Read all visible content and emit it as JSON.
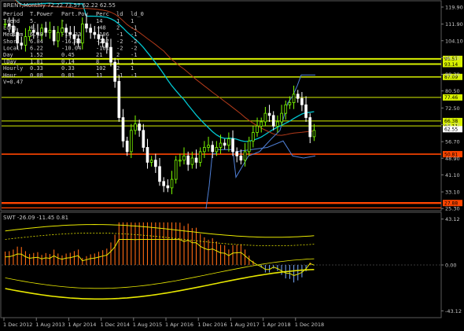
{
  "window": {
    "title": "BRENT,Monthly",
    "ohlc": "72.22 73.57 62.22 62.55"
  },
  "indicator": {
    "title": "SWT -26.09 -11.45 0.81"
  },
  "table": {
    "headers": [
      "Period",
      "T.Power",
      "Part.Pow",
      "Perc",
      "ld",
      "ld_0"
    ],
    "rows": [
      [
        "Trend",
        "5.",
        "-",
        "14",
        "1",
        "1"
      ],
      [
        "Long",
        "4.",
        "-",
        "-48",
        "2",
        "-1"
      ],
      [
        "Medium",
        "6.48",
        "-15.33",
        "-106",
        "-1",
        "-1"
      ],
      [
        "Short",
        "6.84",
        "-16.88",
        "-247",
        "-2",
        "-2"
      ],
      [
        "Local",
        "6.22",
        "-10.04",
        "-161",
        "-2",
        "-2"
      ],
      [
        "Day",
        "1.52",
        "0.45",
        "21",
        "2",
        "-1"
      ],
      [
        "lDay",
        "1.81",
        "0.14",
        "8",
        "1",
        "1"
      ],
      [
        "Hourly",
        "0.33",
        "0.33",
        "102",
        "2",
        "1"
      ],
      [
        "Hour",
        "0.08",
        "0.01",
        "11",
        "-1",
        "-1"
      ]
    ],
    "footer": "V=0.47"
  },
  "price_axis": {
    "ticks": [
      "119.90",
      "111.90",
      "104.10",
      "96.10",
      "88.30",
      "80.50",
      "72.50",
      "64.70",
      "56.70",
      "48.90",
      "41.10",
      "33.10",
      "25.30"
    ],
    "tags": [
      {
        "value": "95.57",
        "color": "#d7f000"
      },
      {
        "value": "93.14",
        "color": "#d7f000"
      },
      {
        "value": "87.09",
        "color": "#d7f000"
      },
      {
        "value": "77.46",
        "color": "#d7f000"
      },
      {
        "value": "66.38",
        "color": "#d7f000"
      },
      {
        "value": "64.11",
        "color": "#d7f000"
      },
      {
        "value": "62.55",
        "color": "#ffffff"
      },
      {
        "value": "50.81",
        "color": "#ff4500"
      },
      {
        "value": "27.88",
        "color": "#ff4500"
      }
    ]
  },
  "indicator_axis": {
    "ticks": [
      "43.12",
      "0.00",
      "-43.12"
    ]
  },
  "time_axis": {
    "labels": [
      "1 Dec 2012",
      "1 Aug 2013",
      "1 Apr 2014",
      "1 Dec 2014",
      "1 Aug 2015",
      "1 Apr 2016",
      "1 Dec 2016",
      "1 Aug 2017",
      "1 Apr 2018",
      "1 Dec 2018"
    ]
  },
  "colors": {
    "background": "#000000",
    "bull_candle": "#7cfc00",
    "bear_candle": "#ffffff",
    "level_line": "#d7f000",
    "support_line": "#ff4500",
    "moving_average_1": "#00c8d2",
    "moving_average_2": "#b23a1a",
    "channel_line": "#4f7fd6",
    "swt_bands": "#e8e800",
    "swt_bars_positive": "#ff6a13",
    "swt_bars_negative": "#6f9be6"
  }
}
